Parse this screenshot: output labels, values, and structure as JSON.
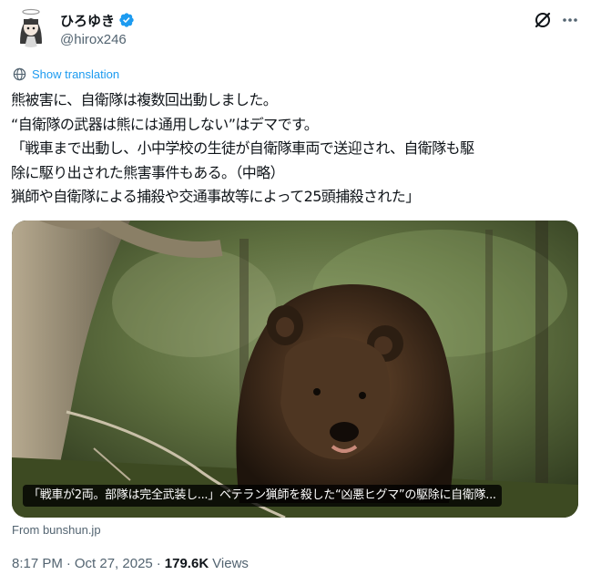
{
  "author": {
    "display_name": "ひろゆき",
    "handle": "@hirox246",
    "verified_color": "#1d9bf0"
  },
  "translate": {
    "label": "Show translation",
    "icon": "globe-icon"
  },
  "tweet": {
    "lines": [
      "熊被害に、自衛隊は複数回出動しました。",
      "“自衛隊の武器は熊には通用しない”はデマです。",
      "「戦車まで出動し、小中学校の生徒が自衛隊車両で送迎され、自衛隊も駆",
      "除に駆り出された熊害事件もある。（中略）",
      "猟師や自衛隊による捕殺や交通事故等によって25頭捕殺された」"
    ]
  },
  "card": {
    "caption": "「戦車が2両。部隊は完全武装し...」ベテラン猟師を殺した“凶悪ヒグマ”の駆除に自衛隊...",
    "source": "From bunshun.jp"
  },
  "meta": {
    "time": "8:17 PM",
    "separator1": "·",
    "date": "Oct 27, 2025",
    "separator2": "·",
    "views_count": "179.6K",
    "views_label": "Views"
  },
  "colors": {
    "text": "#0f1419",
    "secondary": "#536471",
    "accent": "#1d9bf0"
  }
}
